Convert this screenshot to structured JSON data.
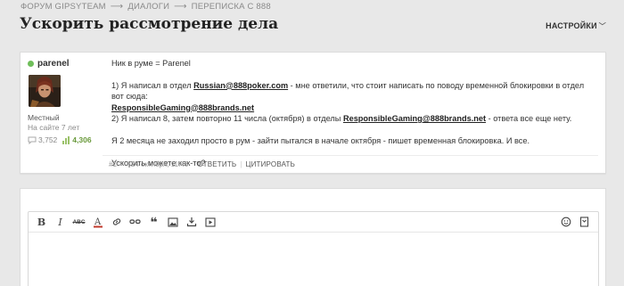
{
  "breadcrumb": [
    "ФОРУМ GIPSYTEAM",
    "ДИАЛОГИ",
    "ПЕРЕПИСКА С 888"
  ],
  "breadcrumb_sep": "⟶",
  "page_title": "Ускорить рассмотрение дела",
  "settings_label": "НАСТРОЙКИ",
  "post": {
    "username": "parenel",
    "role": "Местный",
    "since": "На сайте 7 лет",
    "messages": "3,752",
    "likes": "4,306",
    "body": {
      "l1": "Ник в руме = Parenel",
      "l2a": "1) Я написал в отдел ",
      "l2link": "Russian@888poker.com",
      "l2b": " - мне ответили, что стоит написать по поводу временной блокировки в отдел вот сюда:",
      "l3link": "ResponsibleGaming@888brands.net",
      "l4a": "2) Я написал 8, затем повторно 11 числа (октября) в отделы ",
      "l4link": "ResponsibleGaming@888brands.net",
      "l4b": " - ответа все еще нету.",
      "l5": "Я 2 месяца не заходил просто в рум - зайти пытался в начале октября - пишет временная блокировка. И все.",
      "l6": "Ускорить можете как-то?"
    },
    "number": "#1",
    "date": "24 октября, 11:46",
    "reply_label": "ОТВЕТИТЬ",
    "quote_label": "ЦИТИРОВАТЬ"
  },
  "editor": {
    "toolbar": [
      {
        "name": "bold-button",
        "glyph": "B"
      },
      {
        "name": "italic-button",
        "glyph": "I"
      },
      {
        "name": "strikethrough-button",
        "glyph": "ABC"
      },
      {
        "name": "text-color-button",
        "glyph": "A"
      },
      {
        "name": "link-button",
        "glyph": "link"
      },
      {
        "name": "unlink-button",
        "glyph": "unlink"
      },
      {
        "name": "quote-button",
        "glyph": "❝"
      },
      {
        "name": "image-button",
        "glyph": "image"
      },
      {
        "name": "upload-button",
        "glyph": "upload"
      },
      {
        "name": "video-button",
        "glyph": "video"
      }
    ],
    "accent": "#c0392b"
  },
  "colors": {
    "online": "#6fbe5a",
    "likes": "#6a9a3c",
    "page_bg": "#e8e8e8"
  }
}
